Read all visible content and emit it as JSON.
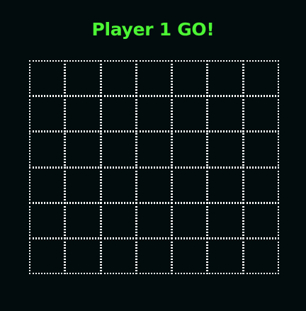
{
  "header": {
    "title": "Player 1 GO!"
  },
  "board": {
    "columns": 7,
    "rows": 6,
    "cells": [
      [
        "",
        "",
        "",
        "",
        "",
        "",
        ""
      ],
      [
        "",
        "",
        "",
        "",
        "",
        "",
        ""
      ],
      [
        "",
        "",
        "",
        "",
        "",
        "",
        ""
      ],
      [
        "",
        "",
        "",
        "",
        "",
        "",
        ""
      ],
      [
        "",
        "",
        "",
        "",
        "",
        "",
        ""
      ],
      [
        "",
        "",
        "",
        "",
        "",
        "",
        ""
      ]
    ]
  },
  "colors": {
    "background": "#020c0d",
    "title": "#4cf534",
    "grid_line": "#ffffff"
  }
}
